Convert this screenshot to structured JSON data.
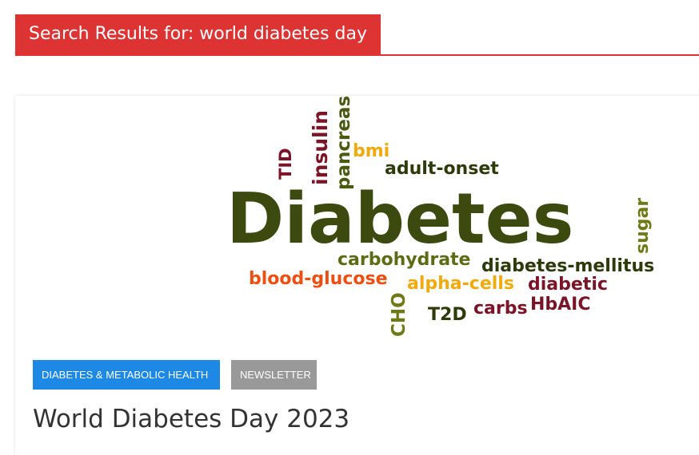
{
  "search": {
    "heading": "Search Results for: world diabetes day"
  },
  "post": {
    "image_alt": "Diabetes word cloud",
    "word_cloud": [
      {
        "word": "Diabetes",
        "color": "#3d4a0f"
      },
      {
        "word": "insulin",
        "color": "#7a1426"
      },
      {
        "word": "pancreas",
        "color": "#4a5a10"
      },
      {
        "word": "TID",
        "color": "#7a1426"
      },
      {
        "word": "bmi",
        "color": "#f2a90b"
      },
      {
        "word": "adult-onset",
        "color": "#2d3a0a"
      },
      {
        "word": "sugar",
        "color": "#6d7a16"
      },
      {
        "word": "carbohydrate",
        "color": "#5c6b14"
      },
      {
        "word": "diabetes-mellitus",
        "color": "#2d3a0a"
      },
      {
        "word": "blood-glucose",
        "color": "#ee4f10"
      },
      {
        "word": "alpha-cells",
        "color": "#f2a90b"
      },
      {
        "word": "diabetic",
        "color": "#7a1426"
      },
      {
        "word": "CHO",
        "color": "#6d7a16"
      },
      {
        "word": "T2D",
        "color": "#2d3a0a"
      },
      {
        "word": "carbs",
        "color": "#7a1426"
      },
      {
        "word": "HbAIC",
        "color": "#7a1426"
      }
    ],
    "categories": [
      {
        "label": "DIABETES & METABOLIC HEALTH",
        "color": "#1e88e5"
      },
      {
        "label": "NEWSLETTER",
        "color": "#999999"
      }
    ],
    "title": "World Diabetes Day 2023"
  }
}
